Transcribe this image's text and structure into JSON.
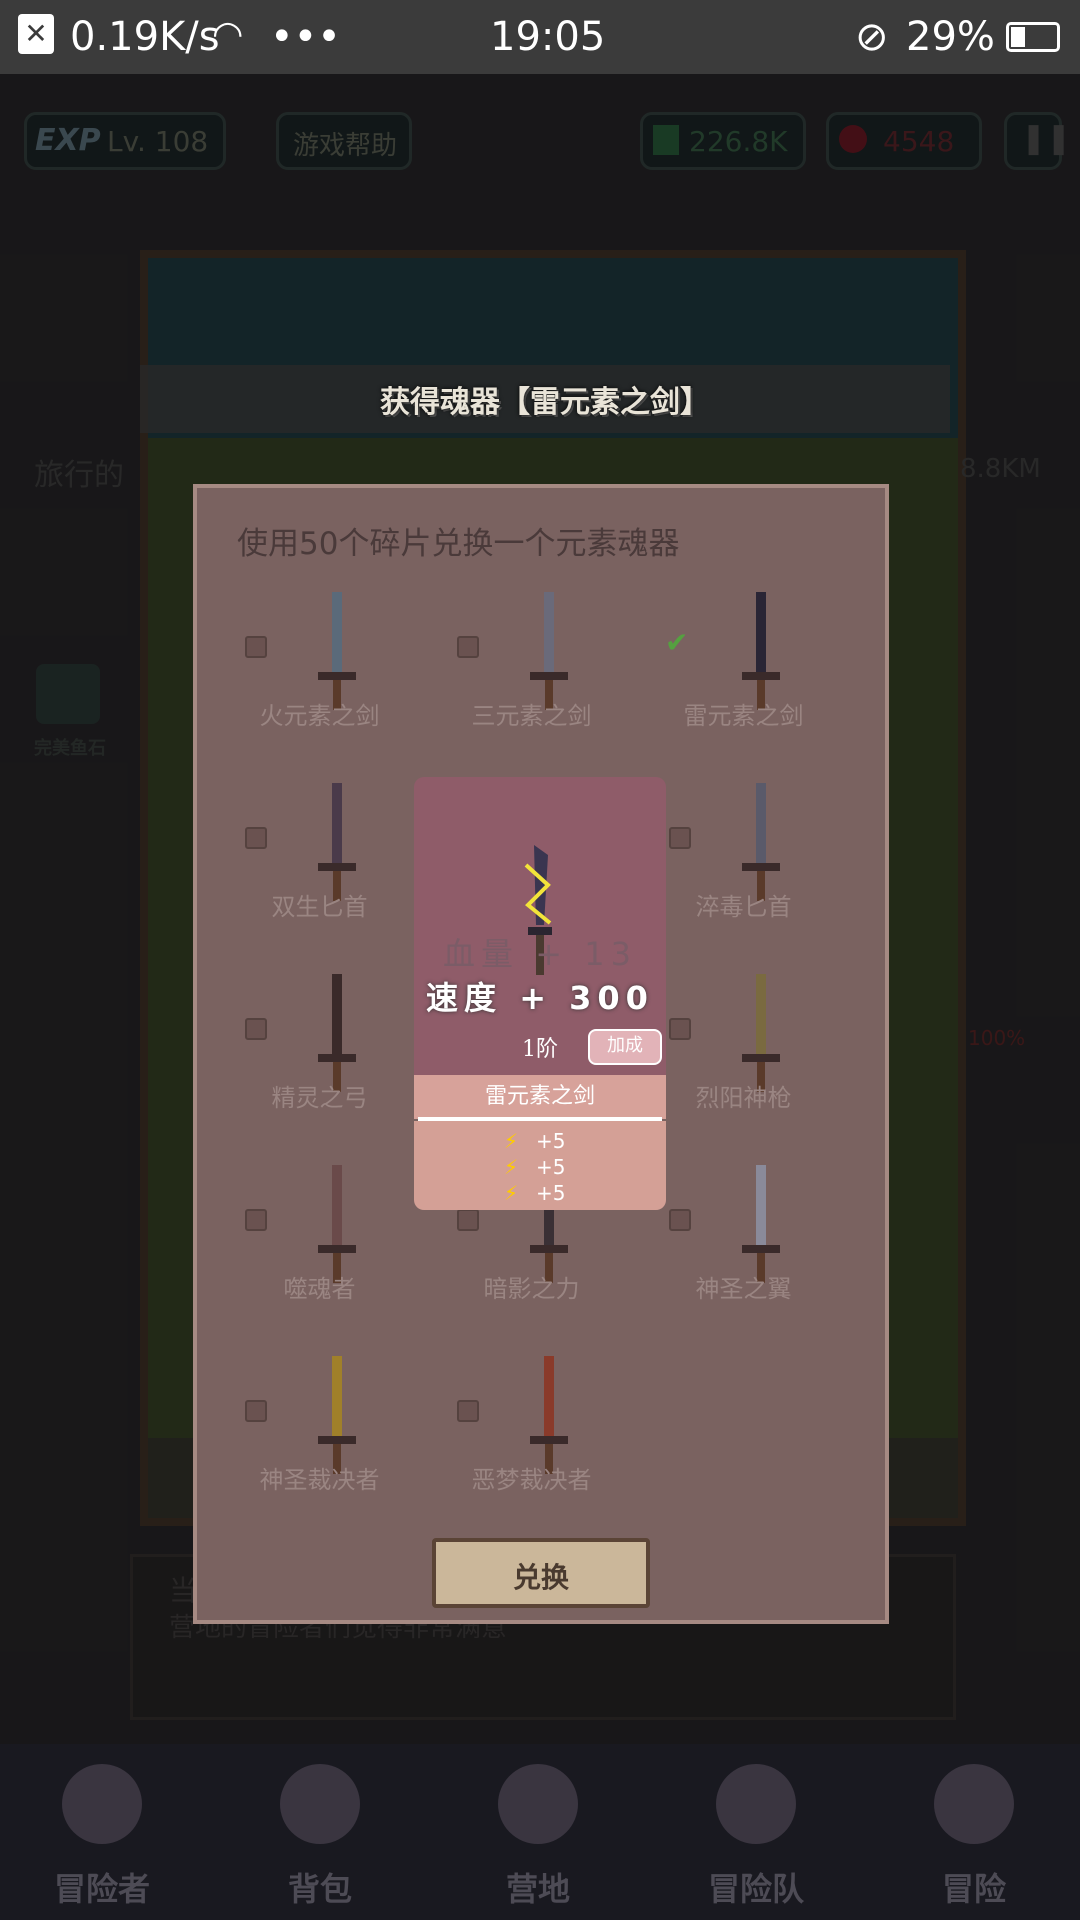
{
  "status_bar": {
    "speed": "0.19K/s",
    "time": "19:05",
    "battery": "29%"
  },
  "hud": {
    "exp_label": "EXP",
    "level": "Lv. 108",
    "help": "游戏帮助",
    "gold": "226.8K",
    "gems": "4548",
    "pause_icon": "pause-icon"
  },
  "background": {
    "left_text": "旅行的",
    "right_text": "8.8KM",
    "left_item": "完美鱼石",
    "log_line1": "当",
    "log_line2": "营地的冒险者们觉得非常满意",
    "percent": "100%"
  },
  "banner": {
    "text": "获得魂器【雷元素之剑】"
  },
  "dialog": {
    "title": "使用50个碎片兑换一个元素魂器",
    "items": [
      {
        "label": "火元素之剑",
        "checked": false
      },
      {
        "label": "三元素之剑",
        "checked": false
      },
      {
        "label": "雷元素之剑",
        "checked": true
      },
      {
        "label": "双生匕首",
        "checked": false
      },
      {
        "label": "",
        "checked": false
      },
      {
        "label": "淬毒匕首",
        "checked": false
      },
      {
        "label": "精灵之弓",
        "checked": false
      },
      {
        "label": "",
        "checked": false
      },
      {
        "label": "烈阳神枪",
        "checked": false
      },
      {
        "label": "噬魂者",
        "checked": false
      },
      {
        "label": "暗影之力",
        "checked": false
      },
      {
        "label": "神圣之翼",
        "checked": false
      },
      {
        "label": "神圣裁决者",
        "checked": false
      },
      {
        "label": "恶梦裁决者",
        "checked": false
      }
    ],
    "exchange_button": "兑换"
  },
  "card": {
    "stat1": "血量 + 13",
    "stat2": "速度 + 300",
    "tier": "1阶",
    "bonus_button": "加成",
    "name": "雷元素之剑",
    "bonuses": [
      "+5",
      "+5",
      "+5"
    ]
  },
  "bottom_nav": [
    {
      "label": "冒险者"
    },
    {
      "label": "背包"
    },
    {
      "label": "营地"
    },
    {
      "label": "冒险队"
    },
    {
      "label": "冒险"
    }
  ],
  "colors": {
    "dialog_bg": "#7a6260",
    "card_top": "#8f5c69",
    "card_bottom": "#d4a096"
  }
}
